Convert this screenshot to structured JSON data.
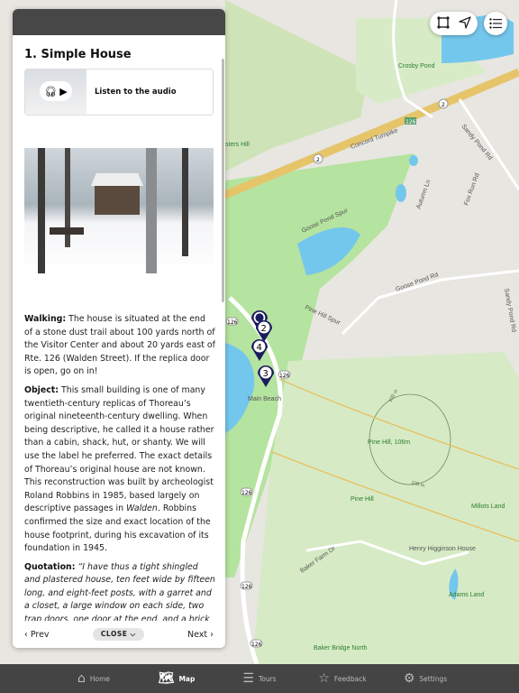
{
  "map": {
    "labels": {
      "crosby_pond": "Crosby Pond",
      "concord_turnpike": "Concord Turnpike",
      "sandy_pond_rd": "Sandy Pond Rd",
      "autumn_ln": "Autumn Ln",
      "fox_run_rd": "Fox Run Rd",
      "goose_pond_spur": "Goose Pond Spur",
      "goose_pond_rd": "Goose Pond Rd",
      "pine_hill_spur": "Pine Hill Spur",
      "main_beach": "Main Beach",
      "pine_hill_summit": "Pine Hill, 106m",
      "pine_hill": "Pine Hill",
      "millots_land": "Millots Land",
      "henry_higginson_house": "Henry Higginson House",
      "baker_farm_dr": "Baker Farm Dr",
      "adams_land": "Adams Land",
      "baker_bridge_north": "Baker Bridge North",
      "sisters_hill": "sters Hill",
      "contour": "100 m",
      "route_126": "126",
      "route_2": "2"
    },
    "markers": [
      "",
      "2",
      "4",
      "3"
    ],
    "marker_color": "#1a1a5e",
    "water_color": "#74c7ec",
    "park_color": "#b5e3a0"
  },
  "controls": {
    "icons": [
      "select-area-icon",
      "locate-icon",
      "list-icon"
    ]
  },
  "panel": {
    "title": "1. Simple House",
    "audio_label": "Listen to the audio",
    "walking_label": "Walking:",
    "walking_text": " The house is situated at the end of a stone dust trail about 100 yards north of the Visitor Center and about 20 yards east of Rte. 126 (Walden Street). If the replica door is open, go on in!",
    "object_label": "Object:",
    "object_text_1": " This small building is one of many twentieth-century replicas of Thoreau’s original nineteenth-century dwelling. When being descriptive, he called it a house rather than a cabin, shack, hut, or shanty. We will use the label he preferred. The exact details of Thoreau’s original house are not known. This reconstruction was built by archeologist Roland Robbins in 1985, based largely on descriptive passages in ",
    "object_italic": "Walden",
    "object_text_2": ". Robbins confirmed the size and exact location of the house footprint, during his excavation of its foundation in 1945.",
    "quotation_label": "Quotation:",
    "quotation_text": " “I have thus a tight shingled and plastered house, ten feet wide by fifteen long, and eight-feet posts, with a garret and a closet, a large window on each side, two trap doors, one door at the end, and a brick",
    "prev": "Prev",
    "close": "CLOSE",
    "next": "Next"
  },
  "tabbar": [
    {
      "label": "Home",
      "icon": "home-icon"
    },
    {
      "label": "Map",
      "icon": "map-icon",
      "active": true
    },
    {
      "label": "Tours",
      "icon": "signpost-icon"
    },
    {
      "label": "Feedback",
      "icon": "star-icon"
    },
    {
      "label": "Settings",
      "icon": "gear-icon"
    }
  ]
}
